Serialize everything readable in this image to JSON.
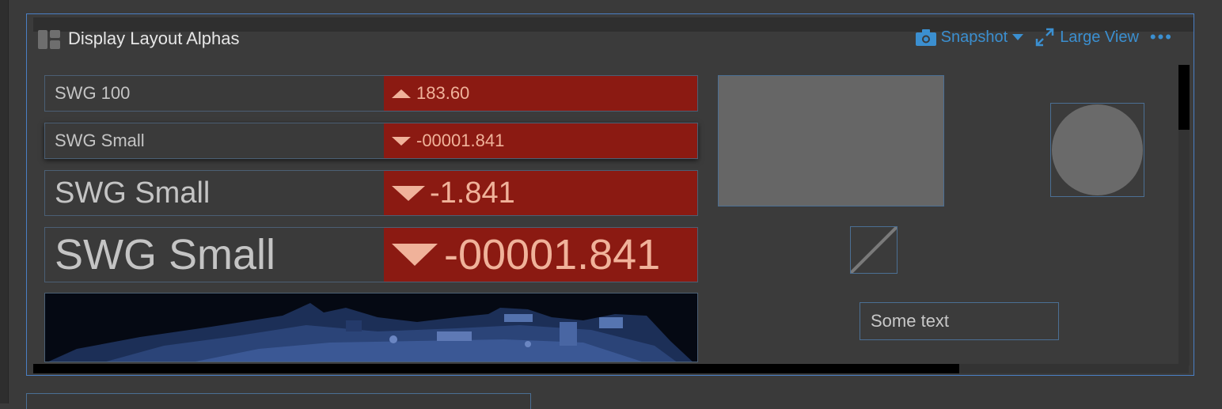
{
  "panel": {
    "title": "Display Layout Alphas",
    "actions": {
      "snapshot_label": "Snapshot",
      "large_view_label": "Large View",
      "more_label": "•••"
    }
  },
  "widgets": [
    {
      "label": "SWG 100",
      "value": "183.60",
      "trend": "up"
    },
    {
      "label": "SWG Small",
      "value": "-00001.841",
      "trend": "down"
    },
    {
      "label": "SWG Small",
      "value": "-1.841",
      "trend": "down"
    },
    {
      "label": "SWG Small",
      "value": "-00001.841",
      "trend": "down"
    }
  ],
  "text_widget": {
    "text": "Some text"
  },
  "colors": {
    "accent": "#3b8fd0",
    "selection_border": "#4a7fc4",
    "alarm_red": "#8b1a12",
    "alarm_text": "#f0b29a",
    "shape_gray": "#666666"
  },
  "icons": {
    "layout": "layout-icon",
    "snapshot": "camera-icon",
    "dropdown": "caret-down-icon",
    "large_view": "expand-icon",
    "more": "more-icon"
  }
}
